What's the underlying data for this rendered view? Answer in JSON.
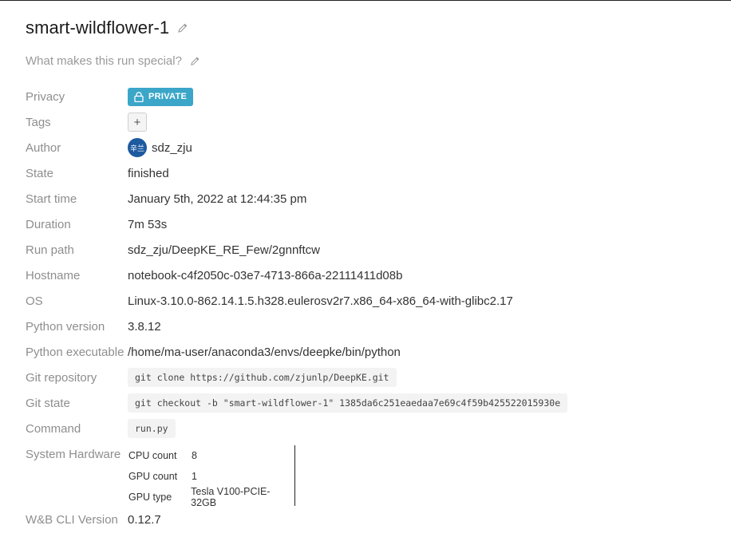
{
  "run": {
    "title": "smart-wildflower-1",
    "description_placeholder": "What makes this run special?"
  },
  "fields": {
    "privacy": {
      "label": "Privacy",
      "badge": "PRIVATE"
    },
    "tags": {
      "label": "Tags",
      "add_button": "+"
    },
    "author": {
      "label": "Author",
      "avatar_text": "辛兰",
      "name": "sdz_zju"
    },
    "state": {
      "label": "State",
      "value": "finished"
    },
    "start_time": {
      "label": "Start time",
      "value": "January 5th, 2022 at 12:44:35 pm"
    },
    "duration": {
      "label": "Duration",
      "value": "7m 53s"
    },
    "run_path": {
      "label": "Run path",
      "value": "sdz_zju/DeepKE_RE_Few/2gnnftcw"
    },
    "hostname": {
      "label": "Hostname",
      "value": "notebook-c4f2050c-03e7-4713-866a-22111411d08b"
    },
    "os": {
      "label": "OS",
      "value": "Linux-3.10.0-862.14.1.5.h328.eulerosv2r7.x86_64-x86_64-with-glibc2.17"
    },
    "python_version": {
      "label": "Python version",
      "value": "3.8.12"
    },
    "python_executable": {
      "label": "Python executable",
      "value": "/home/ma-user/anaconda3/envs/deepke/bin/python"
    },
    "git_repository": {
      "label": "Git repository",
      "value": "git clone https://github.com/zjunlp/DeepKE.git"
    },
    "git_state": {
      "label": "Git state",
      "value": "git checkout -b \"smart-wildflower-1\" 1385da6c251eaedaa7e69c4f59b425522015930e"
    },
    "command": {
      "label": "Command",
      "value": "run.py"
    },
    "system_hardware": {
      "label": "System Hardware",
      "rows": [
        {
          "key": "CPU count",
          "value": "8"
        },
        {
          "key": "GPU count",
          "value": "1"
        },
        {
          "key": "GPU type",
          "value": "Tesla V100-PCIE-32GB"
        }
      ]
    },
    "cli_version": {
      "label": "W&B CLI Version",
      "value": "0.12.7"
    }
  },
  "colors": {
    "badge": "#3ba6c8",
    "avatar": "#1e5aa0",
    "label": "#8e8e8e"
  }
}
